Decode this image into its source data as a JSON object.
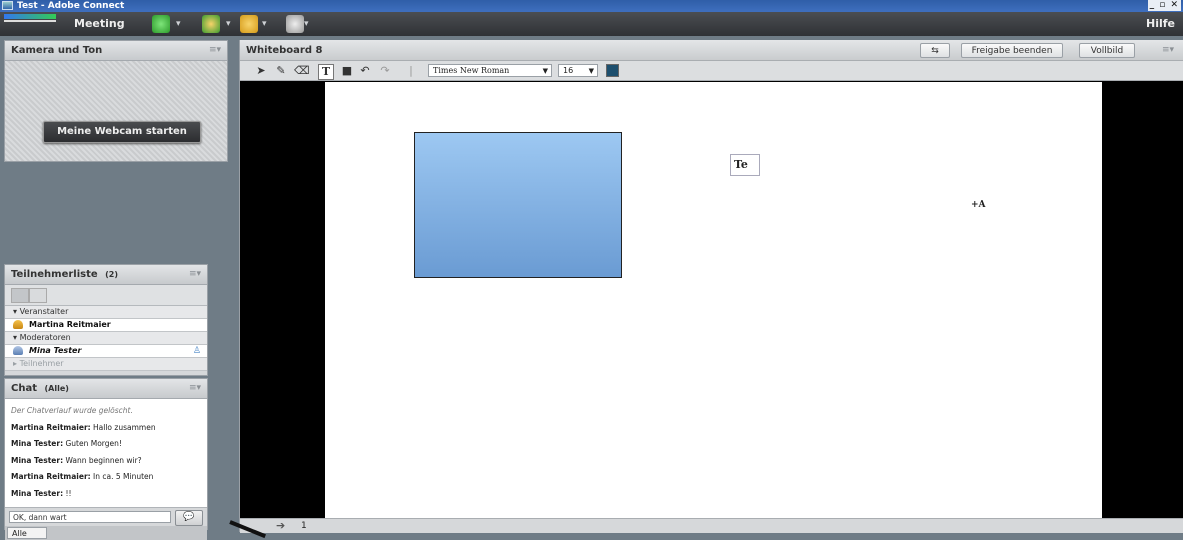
{
  "window": {
    "title": "Test - Adobe Connect",
    "controls": "_ ▫ ✕"
  },
  "menubar": {
    "meeting": "Meeting",
    "help": "Hilfe"
  },
  "kamera": {
    "title": "Kamera und Ton",
    "start_webcam": "Meine Webcam starten"
  },
  "teilnehmer": {
    "title": "Teilnehmerliste",
    "count": "(2)",
    "groups": [
      {
        "label": "Veranstalter",
        "users": [
          "Martina Reitmaier"
        ]
      },
      {
        "label": "Moderatoren",
        "users": [
          "Mina Tester"
        ]
      },
      {
        "label": "Teilnehmer",
        "users": []
      }
    ]
  },
  "chat": {
    "title": "Chat",
    "scope": "(Alle)",
    "info": "Der Chatverlauf wurde gelöscht.",
    "messages": [
      {
        "author": "Martina Reitmaier:",
        "text": "Hallo zusammen"
      },
      {
        "author": "Mina Tester:",
        "text": "Guten Morgen!"
      },
      {
        "author": "Mina Tester:",
        "text": "Wann beginnen wir?"
      },
      {
        "author": "Martina Reitmaier:",
        "text": "In ca. 5 Minuten"
      },
      {
        "author": "Mina Tester:",
        "text": "!!"
      }
    ],
    "input_value": "OK, dann wart",
    "tab": "Alle"
  },
  "whiteboard": {
    "title": "Whiteboard 8",
    "stop_sharing": "Freigabe beenden",
    "fullscreen": "Vollbild",
    "font": "Times New Roman",
    "size": "16",
    "color": "#1d4f6e",
    "text_box": "Te",
    "cursor_text": "+A",
    "page": "1"
  }
}
